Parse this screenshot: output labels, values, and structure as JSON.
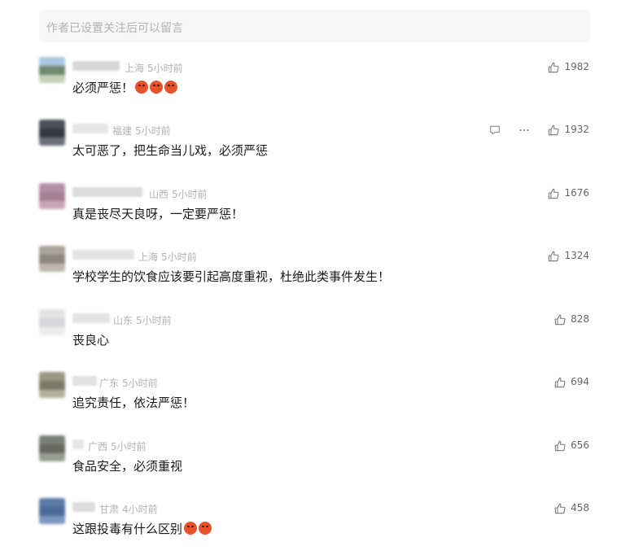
{
  "input": {
    "placeholder": "作者已设置关注后可以留言"
  },
  "comments": [
    {
      "region": "上海",
      "time": "5小时前",
      "text": "必须严惩！",
      "likes": "1982",
      "emojis": 3,
      "avatar": [
        "#a9c6e3",
        "#6f8a6d",
        "#c4d0b8"
      ],
      "nick_color": "#d8d8d8",
      "nick_width": 58,
      "show_menu": false
    },
    {
      "region": "福建",
      "time": "5小时前",
      "text": "太可恶了，把生命当儿戏，必须严惩",
      "likes": "1932",
      "emojis": 0,
      "avatar": [
        "#4a4f5a",
        "#353842",
        "#6a6f7a"
      ],
      "nick_color": "#e6e6e6",
      "nick_width": 44,
      "show_menu": true
    },
    {
      "region": "山西",
      "time": "5小时前",
      "text": "真是丧尽天良呀，一定要严惩！",
      "likes": "1676",
      "emojis": 0,
      "avatar": [
        "#b58fa8",
        "#a77f93",
        "#c9a6b8"
      ],
      "nick_color": "#dcdcdc",
      "nick_width": 86,
      "show_menu": false
    },
    {
      "region": "上海",
      "time": "5小时前",
      "text": "学校学生的饮食应该要引起高度重视，杜绝此类事件发生！",
      "likes": "1324",
      "emojis": 0,
      "avatar": [
        "#a9a39a",
        "#8d877d",
        "#bdb7ad"
      ],
      "nick_color": "#e4e4e4",
      "nick_width": 76,
      "show_menu": false
    },
    {
      "region": "山东",
      "time": "5小时前",
      "text": "丧良心",
      "likes": "828",
      "emojis": 0,
      "avatar": [
        "#e1e2e4",
        "#d5d7da",
        "#ebecee"
      ],
      "nick_color": "#e4e4e4",
      "nick_width": 46,
      "show_menu": false
    },
    {
      "region": "广东",
      "time": "5小时前",
      "text": "追究责任，依法严惩！",
      "likes": "694",
      "emojis": 0,
      "avatar": [
        "#9b9682",
        "#7d7967",
        "#b4b09b"
      ],
      "nick_color": "#e2e2e2",
      "nick_width": 30,
      "show_menu": false
    },
    {
      "region": "广西",
      "time": "5小时前",
      "text": "食品安全，必须重视",
      "likes": "656",
      "emojis": 0,
      "avatar": [
        "#7c7f75",
        "#666960",
        "#9a9d92"
      ],
      "nick_color": "#e6e6e6",
      "nick_width": 14,
      "show_menu": false
    },
    {
      "region": "甘肃",
      "time": "4小时前",
      "text": "这跟投毒有什么区别",
      "likes": "458",
      "emojis": 2,
      "avatar": [
        "#5a7aa8",
        "#4a6a98",
        "#7c97bf"
      ],
      "nick_color": "#dcdcdc",
      "nick_width": 28,
      "show_menu": false
    }
  ],
  "icons": {
    "like": "thumbs-up-icon",
    "reply": "chat-bubble-icon",
    "more": "more-dots-icon"
  },
  "colors": {
    "emoji": "#e8522a",
    "meta_text": "#b2b2b2"
  }
}
